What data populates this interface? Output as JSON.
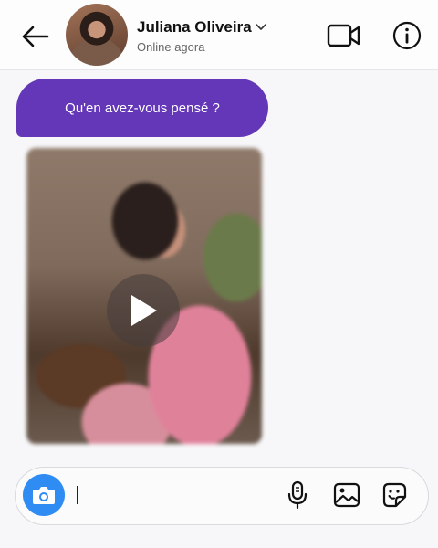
{
  "header": {
    "contact_name": "Juliana Oliveira",
    "status": "Online agora",
    "icons": [
      "back-arrow-icon",
      "chevron-down-icon",
      "video-camera-icon",
      "info-icon"
    ]
  },
  "messages": [
    {
      "type": "text",
      "text": "Qu'en avez-vous pensé ?",
      "color": "#6436b8"
    },
    {
      "type": "video",
      "icon": "play-icon"
    }
  ],
  "composer": {
    "input_value": "",
    "icons": [
      "camera-icon",
      "microphone-icon",
      "image-gallery-icon",
      "sticker-icon"
    ],
    "camera_color": "#2f8cf2"
  }
}
